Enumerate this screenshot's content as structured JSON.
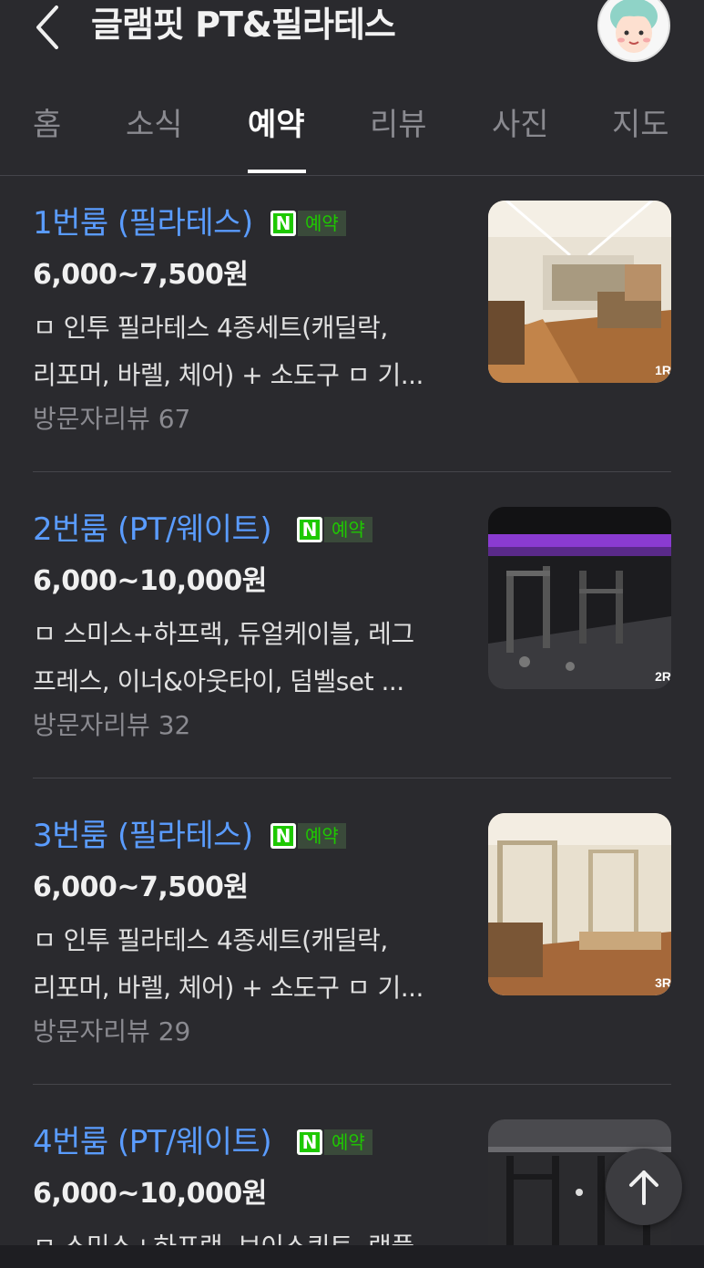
{
  "header": {
    "title": "글램핏 PT&필라테스",
    "back_icon": "chevron-left-icon",
    "avatar_icon": "user-avatar-icon"
  },
  "tabs": [
    {
      "label": "홈",
      "active": false
    },
    {
      "label": "소식",
      "active": false
    },
    {
      "label": "예약",
      "active": true
    },
    {
      "label": "리뷰",
      "active": false
    },
    {
      "label": "사진",
      "active": false
    },
    {
      "label": "지도",
      "active": false
    }
  ],
  "badge": {
    "icon_label": "N",
    "text": "예약",
    "color": "#1ec800"
  },
  "items": [
    {
      "name": "1번룸 (필라테스)",
      "price": "6,000~7,500원",
      "desc_line1": "ㅁ 인투 필라테스 4종세트(캐딜락,",
      "desc_line2": "리포머, 바렐, 체어) + 소도구 ㅁ 기...",
      "review": "방문자리뷰 67",
      "thumb_label": "1R"
    },
    {
      "name": "2번룸 (PT/웨이트)",
      "price": "6,000~10,000원",
      "desc_line1": "ㅁ 스미스+하프랙, 듀얼케이블, 레그",
      "desc_line2": "프레스, 이너&아웃타이, 덤벨set ...",
      "review": "방문자리뷰 32",
      "thumb_label": "2R"
    },
    {
      "name": "3번룸 (필라테스)",
      "price": "6,000~7,500원",
      "desc_line1": "ㅁ 인투 필라테스 4종세트(캐딜락,",
      "desc_line2": "리포머, 바렐, 체어) + 소도구 ㅁ 기...",
      "review": "방문자리뷰 29",
      "thumb_label": "3R"
    },
    {
      "name": "4번룸 (PT/웨이트)",
      "price": "6,000~10,000원",
      "desc_line1": "ㅁ 스미스+하프랙, 브이스쿼트, 랙풀",
      "desc_line2": "",
      "review": "",
      "thumb_label": ""
    }
  ],
  "scroll_top_icon": "arrow-up-icon",
  "colors": {
    "background": "#2a2a2e",
    "link": "#5a9cff",
    "muted": "#8a8a90"
  }
}
